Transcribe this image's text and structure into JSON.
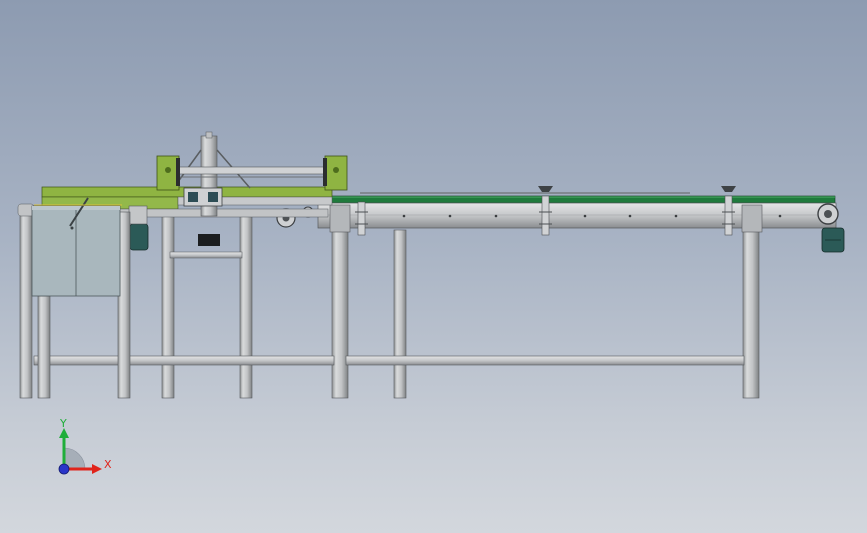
{
  "viewport": {
    "background_top": "#8d9bb1",
    "background_bottom": "#d3d7dd"
  },
  "triad": {
    "x_label": "X",
    "y_label": "Y",
    "x_color": "#e0241b",
    "y_color": "#1fae3a",
    "z_color": "#2a35c9"
  },
  "model": {
    "frame_color": "#c4c6c8",
    "belt_color": "#1f7a3c",
    "plate_color": "#8fb442",
    "motor_color": "#2b5a57",
    "panel_color": "#a9b7bd"
  }
}
